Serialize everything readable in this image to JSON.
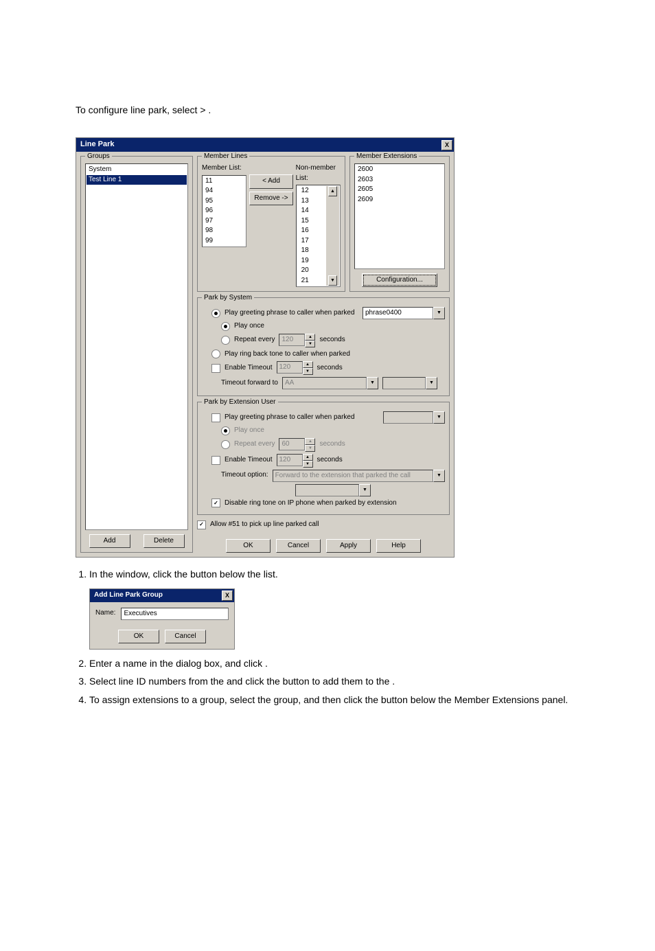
{
  "intro_text": "To configure line park, select        >                                   .",
  "dlg": {
    "title": "Line Park",
    "close": "X",
    "groups": {
      "legend": "Groups",
      "items": [
        "System",
        "Test Line 1"
      ],
      "add": "Add",
      "delete": "Delete"
    },
    "memberLines": {
      "legend": "Member Lines",
      "memberList": "Member List:",
      "nonMemberList": "Non-member List:",
      "members": [
        "11",
        "94",
        "95",
        "96",
        "97",
        "98",
        "99"
      ],
      "nonmembers": [
        "12",
        "13",
        "14",
        "15",
        "16",
        "17",
        "18",
        "19",
        "20",
        "21"
      ],
      "addBtn": "< Add",
      "removeBtn": "Remove ->"
    },
    "memberExt": {
      "legend": "Member Extensions",
      "items": [
        "2600",
        "2603",
        "2605",
        "2609"
      ],
      "config": "Configuration..."
    },
    "parkSys": {
      "legend": "Park by System",
      "playGreeting": "Play greeting phrase to caller when parked",
      "phrase": "phrase0400",
      "playOnce": "Play once",
      "repeatEvery": "Repeat every",
      "repeatVal": "120",
      "seconds": "seconds",
      "ringBack": "Play ring back tone to caller when parked",
      "enableTimeout": "Enable Timeout",
      "timeoutVal": "120",
      "timeoutFwd": "Timeout forward to",
      "aa": "AA"
    },
    "parkExt": {
      "legend": "Park by Extension User",
      "playGreeting": "Play greeting phrase to caller when parked",
      "playOnce": "Play once",
      "repeatEvery": "Repeat every",
      "repeatVal": "60",
      "seconds": "seconds",
      "enableTimeout": "Enable Timeout",
      "timeoutVal": "120",
      "timeoutOpt": "Timeout option:",
      "fwdExt": "Forward to the extension that parked the call"
    },
    "disableRing": "Disable ring tone on IP phone when parked by extension",
    "allow51": "Allow #51 to pick up line parked call",
    "ok": "OK",
    "cancel": "Cancel",
    "apply": "Apply",
    "help": "Help"
  },
  "steps": {
    "s1a": "In the ",
    "s1b": " window, click the ",
    "s1c": " button below the ",
    "s1d": " list.",
    "s2": "Enter a name in the dialog box, and click       .",
    "s3": "Select line ID numbers from the                          and click the           button to add them to the                .",
    "s4": "To assign extensions to a group, select the group, and then click the                          button below the Member Extensions panel."
  },
  "addDlg": {
    "title": "Add Line Park Group",
    "name": "Name:",
    "value": "Executives",
    "ok": "OK",
    "cancel": "Cancel"
  }
}
